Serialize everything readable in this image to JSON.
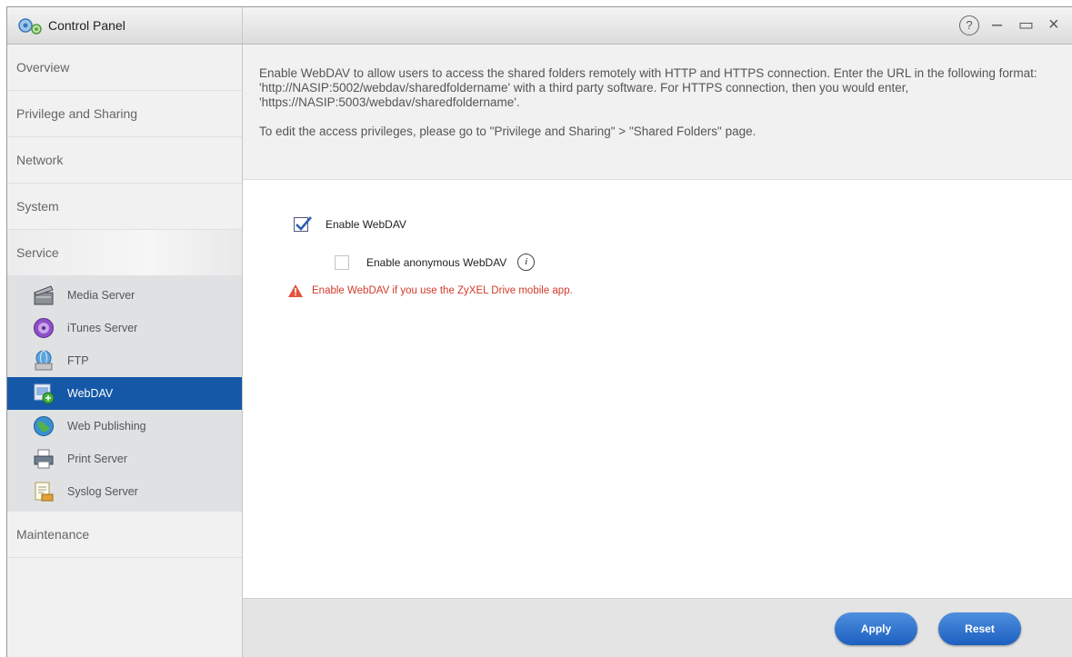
{
  "window": {
    "title": "Control Panel",
    "help_icon": "?",
    "minimize_icon": "–",
    "maximize_icon": "▭",
    "close_icon": "×"
  },
  "sidebar": {
    "items": [
      {
        "label": "Overview"
      },
      {
        "label": "Privilege and Sharing"
      },
      {
        "label": "Network"
      },
      {
        "label": "System"
      },
      {
        "label": "Service"
      }
    ],
    "service_items": [
      {
        "label": "Media Server",
        "icon": "media-server-icon"
      },
      {
        "label": "iTunes Server",
        "icon": "itunes-server-icon"
      },
      {
        "label": "FTP",
        "icon": "ftp-icon"
      },
      {
        "label": "WebDAV",
        "icon": "webdav-icon",
        "active": true
      },
      {
        "label": "Web Publishing",
        "icon": "web-publishing-icon"
      },
      {
        "label": "Print Server",
        "icon": "print-server-icon"
      },
      {
        "label": "Syslog Server",
        "icon": "syslog-server-icon"
      }
    ],
    "maintenance": {
      "label": "Maintenance"
    }
  },
  "info": {
    "paragraph1": "Enable WebDAV to allow users to access the shared folders remotely with HTTP and HTTPS connection. Enter the URL in the following format: 'http://NASIP:5002/webdav/sharedfoldername' with a third party software. For HTTPS connection, then you would enter, 'https://NASIP:5003/webdav/sharedfoldername'.",
    "paragraph2": "To edit the access privileges, please go to \"Privilege and Sharing\" > \"Shared Folders\" page."
  },
  "settings": {
    "enable_webdav": {
      "label": "Enable WebDAV",
      "checked": true
    },
    "enable_anonymous": {
      "label": "Enable anonymous WebDAV",
      "checked": false,
      "info_icon": "i"
    },
    "warning": "Enable WebDAV if you use the ZyXEL Drive mobile app."
  },
  "footer": {
    "apply_label": "Apply",
    "reset_label": "Reset"
  },
  "colors": {
    "accent": "#1558a8",
    "warning": "#d23a2a",
    "button": "#2a6cc8"
  }
}
